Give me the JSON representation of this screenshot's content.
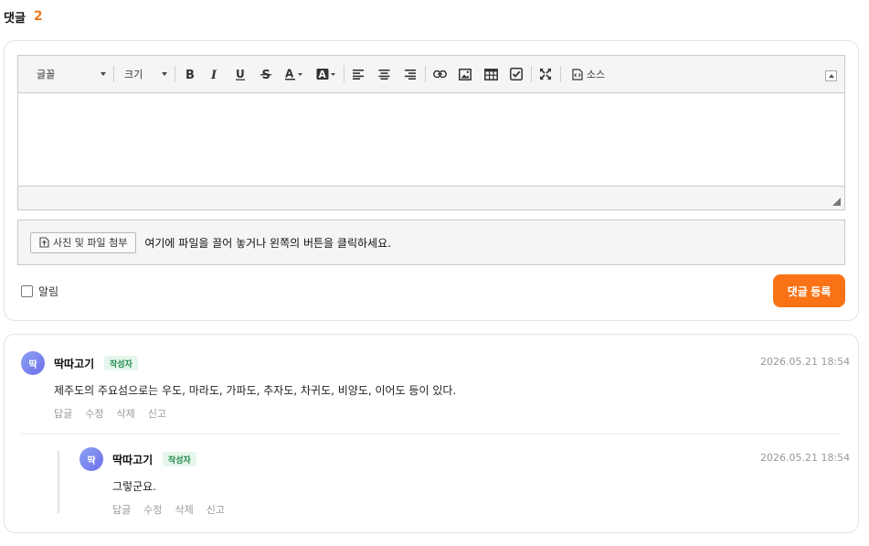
{
  "header": {
    "title": "댓글",
    "count": "2"
  },
  "editor": {
    "font_select": "글꼴",
    "size_select": "크기",
    "source_label": "소스",
    "icons": [
      "bold-icon",
      "italic-icon",
      "underline-icon",
      "strikethrough-icon",
      "font-color-icon",
      "background-color-icon",
      "align-left-icon",
      "align-center-icon",
      "align-right-icon",
      "link-icon",
      "image-icon",
      "table-icon",
      "checklist-icon",
      "fullscreen-icon",
      "source-icon"
    ]
  },
  "attach": {
    "button_label": "사진 및 파일 첨부",
    "hint": "여기에 파일을 끌어 놓거나 왼쪽의 버튼을 클릭하세요."
  },
  "notify_label": "알림",
  "submit_label": "댓글 등록",
  "comments": [
    {
      "avatar": "딱",
      "author": "딱따고기",
      "badge": "작성자",
      "date": "2026.05.21 18:54",
      "body": "제주도의 주요섬으로는 우도, 마라도, 가파도, 추자도, 차귀도, 비양도, 이어도 등이 있다.",
      "actions": [
        "답글",
        "수정",
        "삭제",
        "신고"
      ]
    },
    {
      "avatar": "딱",
      "author": "딱따고기",
      "badge": "작성자",
      "date": "2026.05.21 18:54",
      "body": "그렇군요.",
      "actions": [
        "답글",
        "수정",
        "삭제",
        "신고"
      ]
    }
  ]
}
